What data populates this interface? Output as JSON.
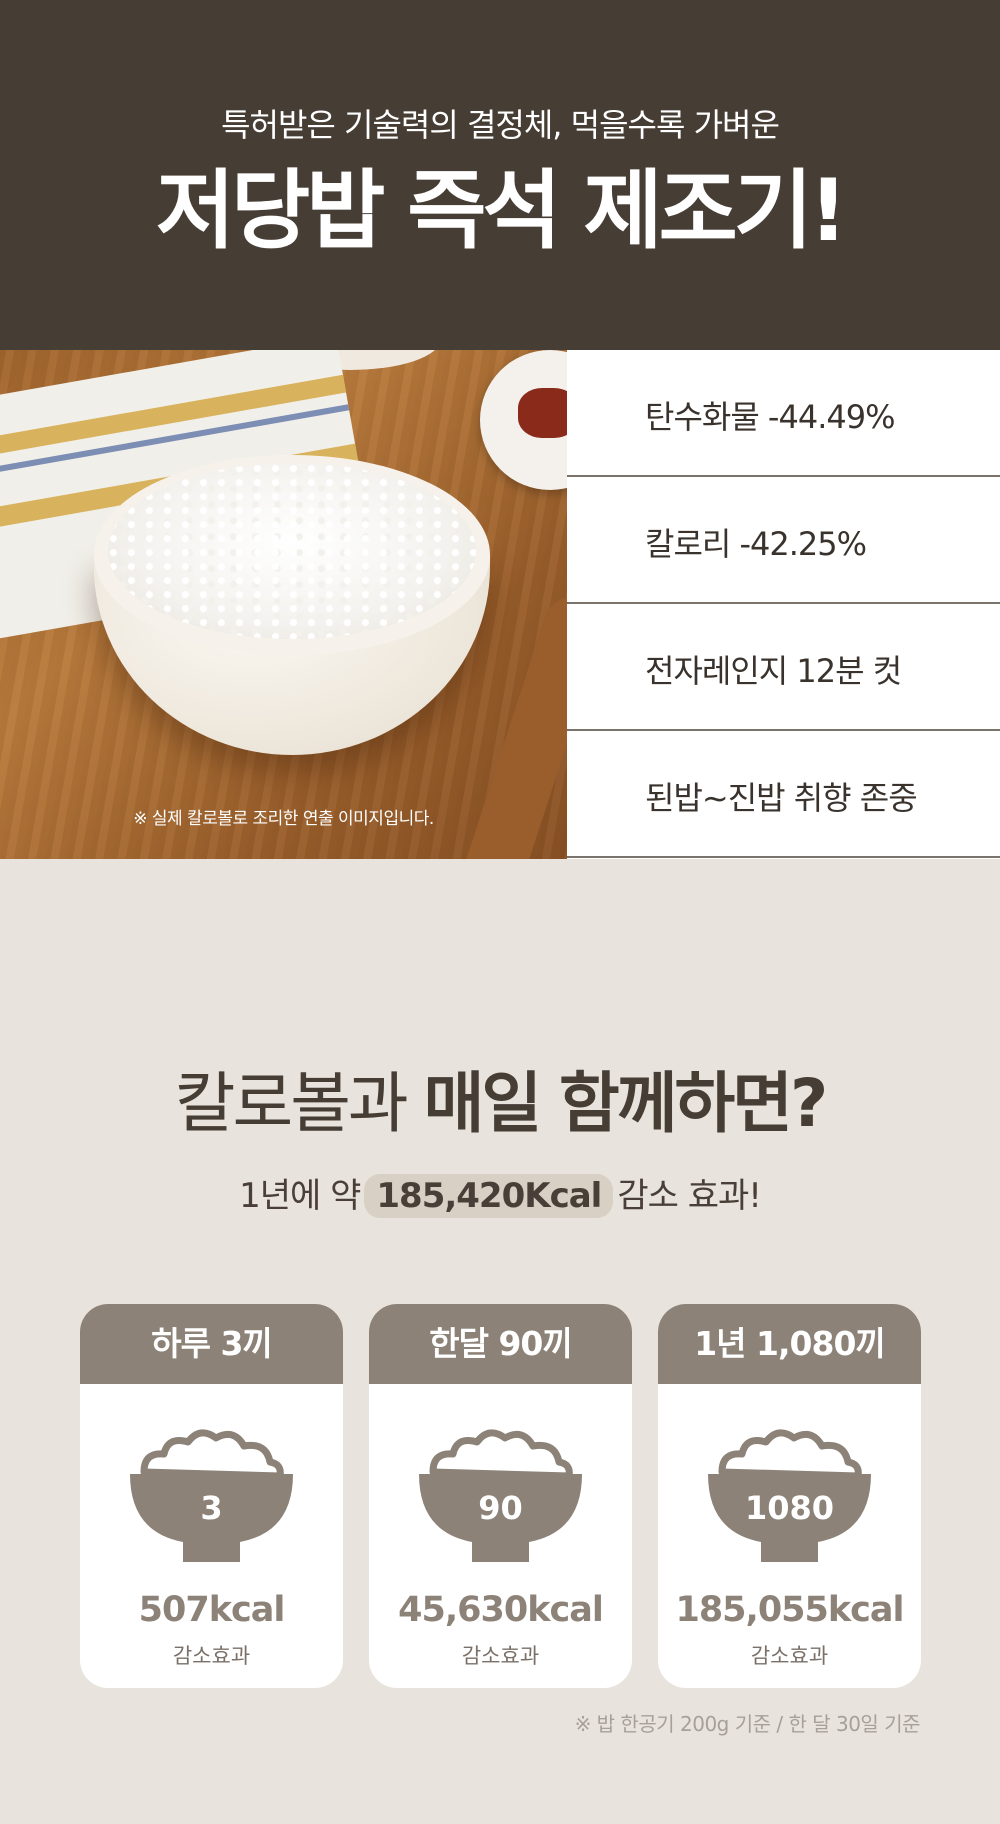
{
  "hero": {
    "subtitle": "특허받은 기술력의 결정체, 먹을수록 가벼운",
    "title": "저당밥 즉석 제조기!"
  },
  "photo": {
    "note": "※ 실제 칼로볼로 조리한 연출 이미지입니다."
  },
  "stats": [
    {
      "label": "탄수화물 -44.49%"
    },
    {
      "label": "칼로리 -42.25%"
    },
    {
      "label": "전자레인지 12분 컷"
    },
    {
      "label": "된밥~진밥 취향 존중"
    }
  ],
  "section": {
    "heading_light": "칼로볼과 ",
    "heading_bold": "매일 함께하면?",
    "effect_prefix": "1년에 약",
    "effect_highlight": "185,420Kcal",
    "effect_suffix": "감소 효과!"
  },
  "cards": [
    {
      "header": "하루 3끼",
      "count": "3",
      "kcal": "507kcal",
      "label": "감소효과"
    },
    {
      "header": "한달 90끼",
      "count": "90",
      "kcal": "45,630kcal",
      "label": "감소효과"
    },
    {
      "header": "1년 1,080끼",
      "count": "1080",
      "kcal": "185,055kcal",
      "label": "감소효과"
    }
  ],
  "footnote": "※ 밥 한공기 200g 기준 / 한 달 30일 기준",
  "icons": {
    "card_icon": "rice-bowl-icon"
  },
  "colors": {
    "hero_bg": "#463d35",
    "page_bg": "#e8e4dd",
    "card_accent": "#8c8278"
  }
}
